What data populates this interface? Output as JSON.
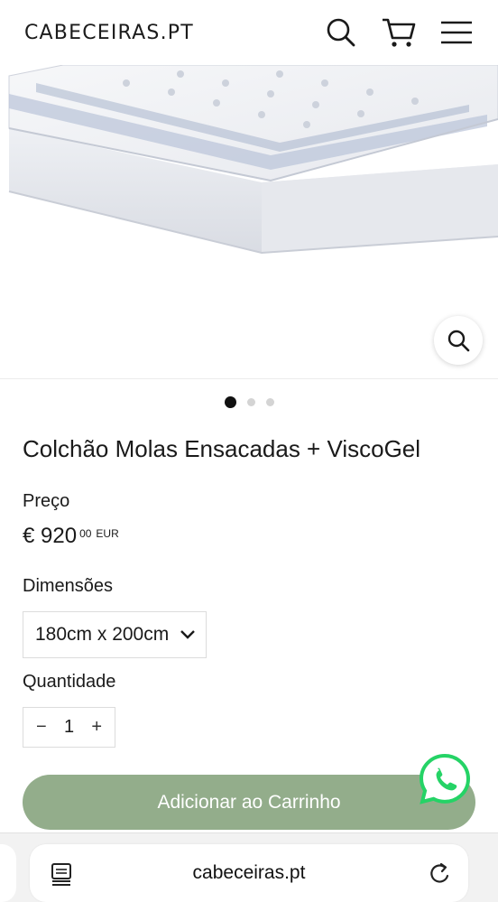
{
  "header": {
    "logo": "CABECEIRAS.PT",
    "icons": [
      "search-icon",
      "cart-icon",
      "menu-icon"
    ]
  },
  "gallery": {
    "slides": 3,
    "active_slide": 1,
    "zoom_icon": "zoom-icon"
  },
  "product": {
    "title": "Colchão Molas Ensacadas + ViscoGel",
    "price_label": "Preço",
    "price_main": "€ 920",
    "price_cents": "00",
    "price_currency": "EUR",
    "dimensions_label": "Dimensões",
    "dimensions_value": "180cm x 200cm",
    "quantity_label": "Quantidade",
    "quantity_value": "1",
    "qty_minus": "−",
    "qty_plus": "+",
    "add_to_cart": "Adicionar ao Carrinho"
  },
  "browser": {
    "url": "cabeceiras.pt"
  },
  "colors": {
    "accent_button": "#93ad8b",
    "whatsapp": "#25d366"
  }
}
